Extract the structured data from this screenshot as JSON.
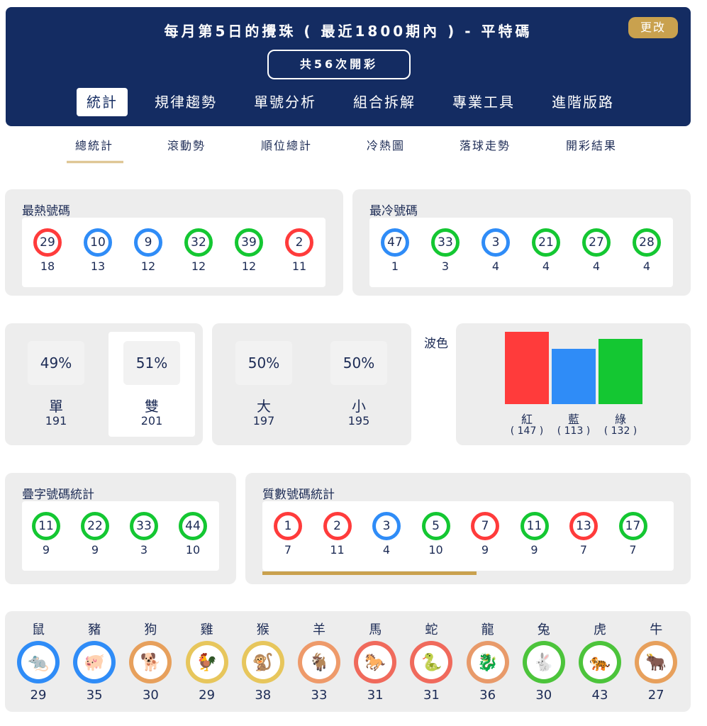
{
  "header": {
    "title": "每月第5日的攪珠 ( 最近1800期內 ) - 平特碼",
    "change_button": "更改",
    "draw_count": "共56次開彩",
    "tabs": [
      "統計",
      "規律趨勢",
      "單號分析",
      "組合拆解",
      "專業工具",
      "進階版路"
    ]
  },
  "sub_tabs": [
    "總統計",
    "滾動勢",
    "順位總計",
    "冷熱圖",
    "落球走勢",
    "開彩結果"
  ],
  "hot": {
    "title": "最熱號碼",
    "balls": [
      {
        "num": "29",
        "count": "18",
        "color": "red"
      },
      {
        "num": "10",
        "count": "13",
        "color": "blue"
      },
      {
        "num": "9",
        "count": "12",
        "color": "blue"
      },
      {
        "num": "32",
        "count": "12",
        "color": "green"
      },
      {
        "num": "39",
        "count": "12",
        "color": "green"
      },
      {
        "num": "2",
        "count": "11",
        "color": "red"
      }
    ]
  },
  "cold": {
    "title": "最冷號碼",
    "balls": [
      {
        "num": "47",
        "count": "1",
        "color": "blue"
      },
      {
        "num": "33",
        "count": "3",
        "color": "green"
      },
      {
        "num": "3",
        "count": "4",
        "color": "blue"
      },
      {
        "num": "21",
        "count": "4",
        "color": "green"
      },
      {
        "num": "27",
        "count": "4",
        "color": "green"
      },
      {
        "num": "28",
        "count": "4",
        "color": "green"
      }
    ]
  },
  "odd_even": {
    "odd": {
      "pct": "49%",
      "label": "單",
      "count": "191"
    },
    "even": {
      "pct": "51%",
      "label": "雙",
      "count": "201"
    }
  },
  "big_small": {
    "big": {
      "pct": "50%",
      "label": "大",
      "count": "197"
    },
    "small": {
      "pct": "50%",
      "label": "小",
      "count": "195"
    }
  },
  "wave": {
    "title": "波色",
    "bars": [
      {
        "label": "紅",
        "count_text": "( 147 )",
        "value": 147,
        "color": "#ff3b3b"
      },
      {
        "label": "藍",
        "count_text": "( 113 )",
        "value": 113,
        "color": "#2f8cf7"
      },
      {
        "label": "綠",
        "count_text": "( 132 )",
        "value": 132,
        "color": "#14c732"
      }
    ]
  },
  "double_digit": {
    "title": "疊字號碼統計",
    "balls": [
      {
        "num": "11",
        "count": "9",
        "color": "green"
      },
      {
        "num": "22",
        "count": "9",
        "color": "green"
      },
      {
        "num": "33",
        "count": "3",
        "color": "green"
      },
      {
        "num": "44",
        "count": "10",
        "color": "green"
      }
    ]
  },
  "prime": {
    "title": "質數號碼統計",
    "balls": [
      {
        "num": "1",
        "count": "7",
        "color": "red"
      },
      {
        "num": "2",
        "count": "11",
        "color": "red"
      },
      {
        "num": "3",
        "count": "4",
        "color": "blue"
      },
      {
        "num": "5",
        "count": "10",
        "color": "green"
      },
      {
        "num": "7",
        "count": "9",
        "color": "red"
      },
      {
        "num": "11",
        "count": "9",
        "color": "green"
      },
      {
        "num": "13",
        "count": "7",
        "color": "red"
      },
      {
        "num": "17",
        "count": "7",
        "color": "green"
      }
    ]
  },
  "zodiac": [
    {
      "name": "鼠",
      "count": "29",
      "icon": "rat-icon",
      "color": "#2f8cf7",
      "glyph": "🐀"
    },
    {
      "name": "豬",
      "count": "35",
      "icon": "pig-icon",
      "color": "#2f8cf7",
      "glyph": "🐖"
    },
    {
      "name": "狗",
      "count": "30",
      "icon": "dog-icon",
      "color": "#e7a05c",
      "glyph": "🐕"
    },
    {
      "name": "雞",
      "count": "29",
      "icon": "rooster-icon",
      "color": "#e7c65c",
      "glyph": "🐓"
    },
    {
      "name": "猴",
      "count": "38",
      "icon": "monkey-icon",
      "color": "#e7c65c",
      "glyph": "🐒"
    },
    {
      "name": "羊",
      "count": "33",
      "icon": "goat-icon",
      "color": "#ee9a6a",
      "glyph": "🐐"
    },
    {
      "name": "馬",
      "count": "31",
      "icon": "horse-icon",
      "color": "#f06a5c",
      "glyph": "🐎"
    },
    {
      "name": "蛇",
      "count": "31",
      "icon": "snake-icon",
      "color": "#f06a5c",
      "glyph": "🐍"
    },
    {
      "name": "龍",
      "count": "36",
      "icon": "dragon-icon",
      "color": "#e89a6a",
      "glyph": "🐉"
    },
    {
      "name": "兔",
      "count": "30",
      "icon": "rabbit-icon",
      "color": "#4cc43b",
      "glyph": "🐇"
    },
    {
      "name": "虎",
      "count": "43",
      "icon": "tiger-icon",
      "color": "#4cc43b",
      "glyph": "🐅"
    },
    {
      "name": "牛",
      "count": "27",
      "icon": "ox-icon",
      "color": "#e7a05c",
      "glyph": "🐂"
    }
  ]
}
